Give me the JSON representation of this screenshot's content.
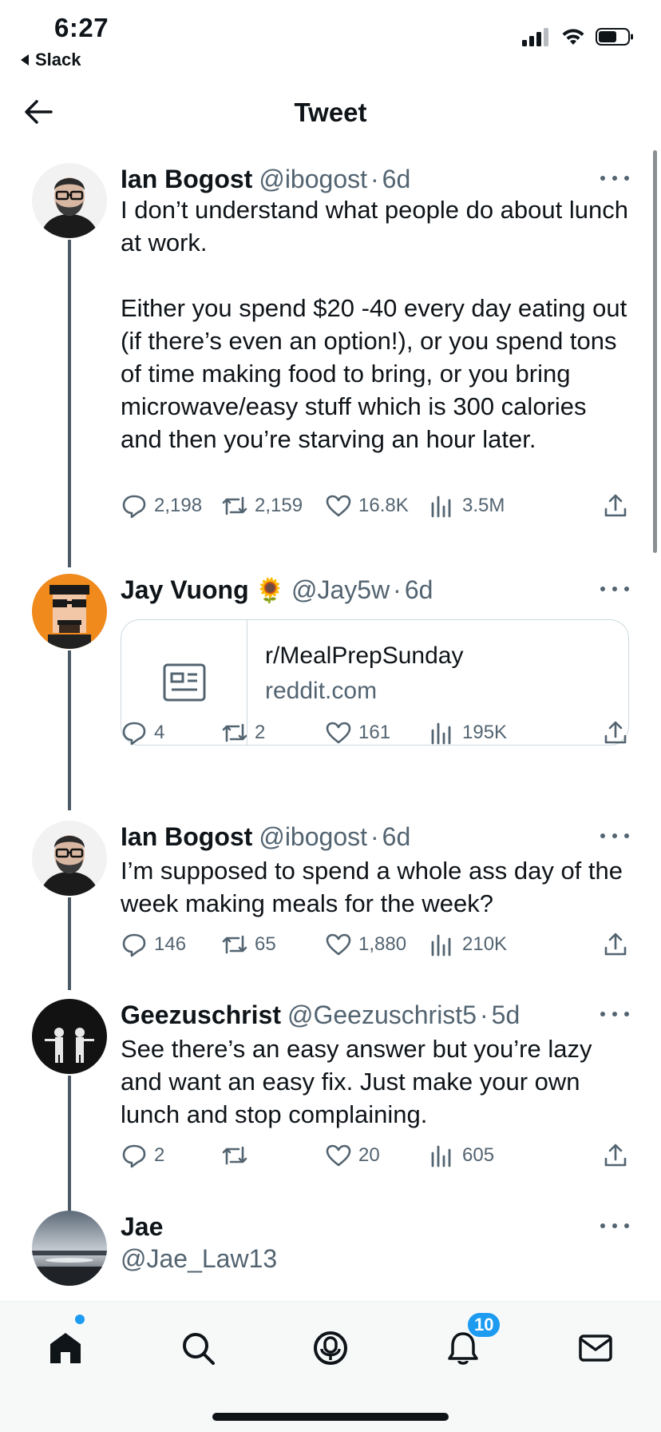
{
  "status_bar": {
    "time": "6:27",
    "back_app": "Slack",
    "icons": [
      "signal-icon",
      "wifi-icon",
      "battery-icon"
    ]
  },
  "header": {
    "title": "Tweet",
    "back_icon": "back-arrow-icon"
  },
  "tweets": [
    {
      "name": "Ian Bogost",
      "handle": "@ibogost",
      "time": "6d",
      "text": "I don’t understand what people do about lunch at work.\n\nEither you spend $20 -40 every day eating out (if there’s even an option!), or you spend tons of time making food to bring, or you bring microwave/easy stuff which is 300 calories and then you’re starving an hour later.",
      "replies": "2,198",
      "retweets": "2,159",
      "likes": "16.8K",
      "views": "3.5M"
    },
    {
      "name": "Jay Vuong",
      "emoji": "🌻",
      "handle": "@Jay5w",
      "time": "6d",
      "card": {
        "title": "r/MealPrepSunday",
        "domain": "reddit.com"
      },
      "replies": "4",
      "retweets": "2",
      "likes": "161",
      "views": "195K"
    },
    {
      "name": "Ian Bogost",
      "handle": "@ibogost",
      "time": "6d",
      "text": "I’m supposed to spend a whole ass day of the week making meals for the week?",
      "replies": "146",
      "retweets": "65",
      "likes": "1,880",
      "views": "210K"
    },
    {
      "name": "Geezuschrist",
      "handle": "@Geezuschrist5",
      "time": "5d",
      "text": "See there’s an easy answer but you’re lazy and want an easy fix.  Just make your own lunch and stop complaining.",
      "replies": "2",
      "retweets": "",
      "likes": "20",
      "views": "605"
    },
    {
      "name": "Jae",
      "handle": "@Jae_Law13"
    }
  ],
  "tab_bar": {
    "items": [
      "home-icon",
      "search-icon",
      "spaces-icon",
      "notifications-icon",
      "messages-icon"
    ],
    "notification_count": "10"
  },
  "colors": {
    "accent": "#1d9bf0",
    "text": "#0f1419",
    "secondary": "#536471",
    "thread_line": "#4b5a66"
  }
}
